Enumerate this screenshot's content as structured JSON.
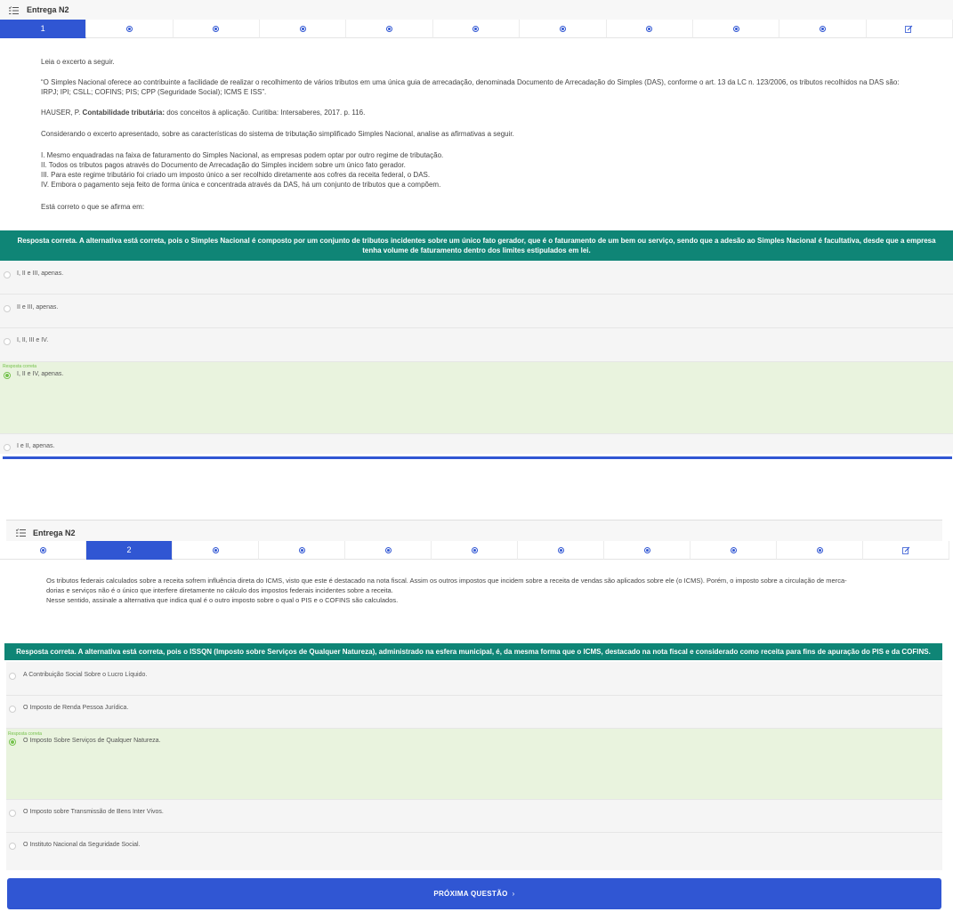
{
  "q1": {
    "header_title": "Entrega N2",
    "nav_active_label": "1",
    "paragraphs": {
      "intro": "Leia o excerto a seguir.",
      "quote": "“O Simples Nacional oferece ao contribuinte a facilidade de realizar o recolhimento de vários tributos em uma única guia de arrecadação, denominada Documento de Arrecadação do Simples (DAS), conforme o art. 13 da LC n. 123/2006, os tributos recolhidos na DAS são: IRPJ; IPI; CSLL; COFINS; PIS; CPP (Seguridade Social); ICMS E ISS”.",
      "ref_author": "HAUSER, P. ",
      "ref_title": "Contabilidade tributária:",
      "ref_rest": " dos conceitos à aplicação. Curitiba: Intersaberes, 2017. p. 116.",
      "consider": "Considerando o excerto apresentado, sobre as características do sistema de tributação simplificado Simples Nacional, analise as afirmativas a seguir.",
      "item1": "I. Mesmo enquadradas na faixa de faturamento do Simples Nacional, as empresas podem optar por outro regime de tributação.",
      "item2": "II. Todos os tributos pagos através do Documento de Arrecadação do Simples incidem sobre um único fato gerador.",
      "item3": "III. Para este regime tributário foi criado um imposto único a ser recolhido diretamente aos cofres da receita federal, o DAS.",
      "item4": "IV. Embora o pagamento seja feito de forma única e concentrada através da DAS, há um conjunto de tributos que a compõem.",
      "prompt": "Está correto o que se afirma em:"
    },
    "feedback": "Resposta correta. A alternativa está correta, pois o Simples Nacional é composto por um conjunto de tributos incidentes sobre um único fato gerador, que é o faturamento de um bem ou serviço, sendo que a adesão ao Simples Nacional é facultativa, desde que a empresa tenha volume de faturamento dentro dos limites estipulados em lei.",
    "correct_tag": "Resposta correta",
    "options": [
      "I, II e III, apenas.",
      "II e III, apenas.",
      "I, II, III e IV.",
      "I, II e IV, apenas.",
      "I e II, apenas."
    ]
  },
  "q2": {
    "header_title": "Entrega N2",
    "nav_active_label": "2",
    "text_line1": "Os tributos federais calculados sobre a receita sofrem influência direta do ICMS, visto que este é destacado na nota fiscal. Assim os outros impostos que incidem sobre a receita de vendas são aplicados sobre ele (o ICMS). Porém, o imposto sobre a circulação de merca-",
    "text_line2": "dorias e serviços não é o único que interfere diretamente no cálculo dos impostos federais incidentes sobre a receita.",
    "text_line3": "Nesse sentido, assinale a alternativa que indica qual é o outro imposto sobre o qual o PIS e o COFINS são calculados.",
    "feedback": "Resposta correta. A alternativa está correta, pois o ISSQN (Imposto sobre Serviços de Qualquer Natureza), administrado na esfera municipal, é, da mesma forma que o ICMS, destacado na nota fiscal e considerado como receita para fins de apuração do PIS e da COFINS.",
    "correct_tag": "Resposta correta",
    "options": [
      "A Contribuição Social Sobre o Lucro Líquido.",
      "O Imposto de Renda Pessoa Jurídica.",
      "O Imposto Sobre Serviços de Qualquer Natureza.",
      "O Imposto sobre Transmissão de Bens Inter Vivos.",
      "O Instituto Nacional da Seguridade Social."
    ]
  },
  "next_button": "PRÓXIMA QUESTÃO",
  "next_arrow": "›",
  "colors": {
    "primary": "#3056d3",
    "banner": "#0f8576",
    "correct_bg": "#e9f3de",
    "correct_accent": "#74c14a"
  }
}
